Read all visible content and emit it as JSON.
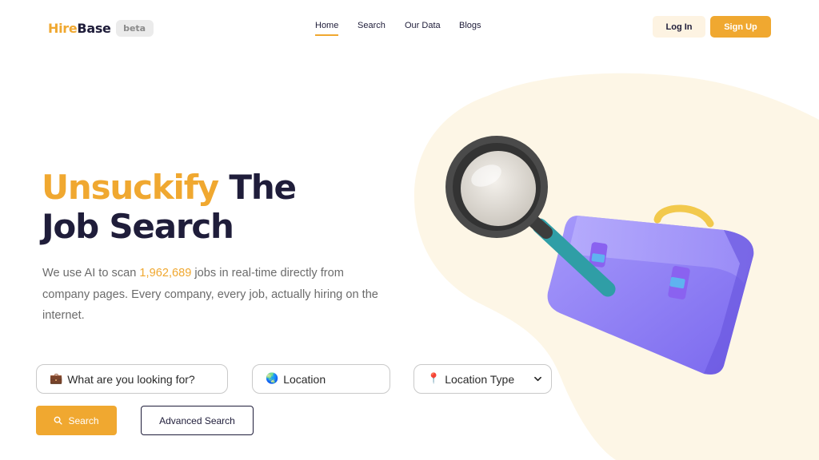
{
  "header": {
    "logo_hire": "Hire",
    "logo_base": "Base",
    "beta_label": "beta",
    "nav": [
      {
        "label": "Home",
        "active": true
      },
      {
        "label": "Search",
        "active": false
      },
      {
        "label": "Our Data",
        "active": false
      },
      {
        "label": "Blogs",
        "active": false
      }
    ],
    "login_label": "Log In",
    "signup_label": "Sign Up"
  },
  "hero": {
    "title_accent": "Unsuckify",
    "title_rest_1": " The",
    "title_line_2": "Job Search",
    "desc_before": "We use AI to scan ",
    "desc_count": "1,962,689",
    "desc_after": " jobs in real-time directly from company pages. Every company, every job, actually hiring on the internet."
  },
  "search": {
    "what_icon": "briefcase-icon",
    "what_emoji": "💼",
    "what_placeholder": "What are you looking for?",
    "location_icon": "globe-icon",
    "location_emoji": "🌏",
    "location_placeholder": "Location",
    "type_icon": "pin-icon",
    "type_emoji": "📍",
    "type_selected": "Location Type",
    "search_label": "Search",
    "advanced_label": "Advanced Search"
  },
  "colors": {
    "accent": "#f0a830",
    "ink": "#1f1d3a",
    "blob": "#fdf6e6",
    "briefcase": "#8b7cf6"
  }
}
